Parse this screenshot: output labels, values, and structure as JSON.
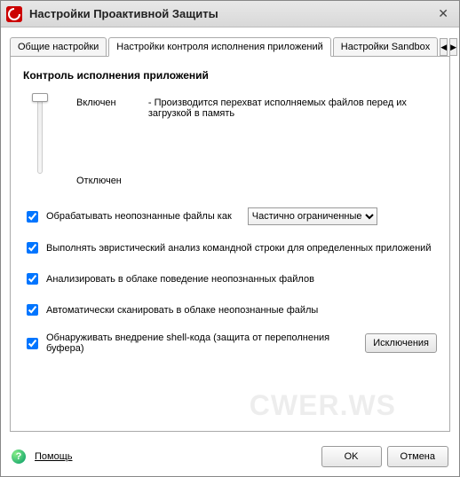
{
  "window": {
    "title": "Настройки Проактивной Защиты"
  },
  "tabs": {
    "tab0": "Общие настройки",
    "tab1": "Настройки контроля исполнения приложений",
    "tab2": "Настройки Sandbox"
  },
  "main": {
    "section_title": "Контроль исполнения приложений",
    "slider_on": "Включен",
    "slider_off": "Отключен",
    "description": "- Производится перехват исполняемых файлов перед их загрузкой в память"
  },
  "options": {
    "opt1": "Обрабатывать неопознанные файлы как",
    "opt1_select": "Частично ограниченные",
    "opt2": "Выполнять эвристический анализ командной строки для определенных приложений",
    "opt3": "Анализировать в облаке поведение неопознанных файлов",
    "opt4": "Автоматически сканировать в облаке неопознанные файлы",
    "opt5": "Обнаруживать внедрение shell-кода (защита от переполнения буфера)",
    "exceptions_btn": "Исключения"
  },
  "footer": {
    "help": "Помощь",
    "ok": "OK",
    "cancel": "Отмена"
  },
  "watermark": "CWER.WS"
}
